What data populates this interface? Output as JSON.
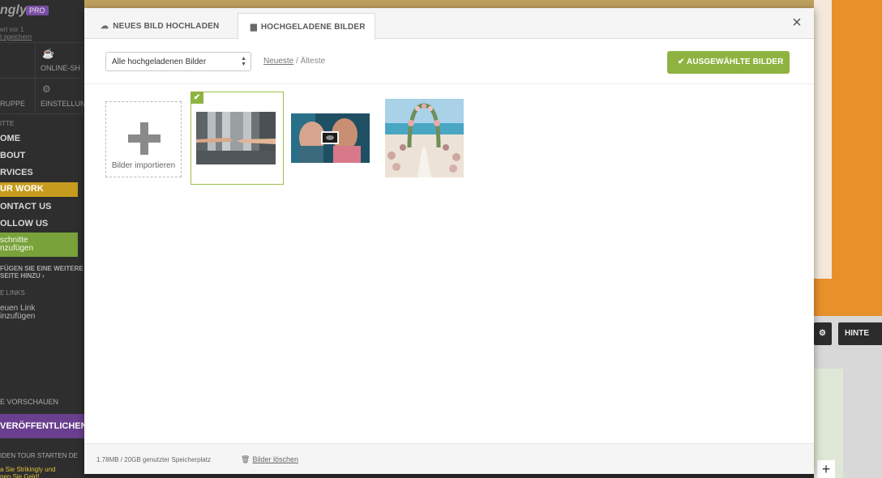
{
  "background": {
    "logo": "ngly",
    "pro_badge": "PRO",
    "saved_note": "ert vor 1\nt speichern",
    "tiles": [
      {
        "label": "",
        "icon": "grid-icon"
      },
      {
        "label": "ONLINE-SH",
        "icon": "shop-icon"
      },
      {
        "label": "RUPPE",
        "icon": "group-icon"
      },
      {
        "label": "EINSTELLUN",
        "icon": "gear-icon"
      }
    ],
    "sections_heading": "ITTE",
    "nav": [
      "OME",
      "BOUT",
      "RVICES"
    ],
    "nav_active": "UR WORK",
    "nav_after": [
      "ONTACT US",
      "OLLOW US"
    ],
    "add_section": "schnitte\nnzufügen",
    "add_page": "FÜGEN SIE EINE WEITERE\nSEITE HINZU ›",
    "links_heading": "E LINKS",
    "new_link": "euen Link\ninzufügen",
    "preview": "E VORSCHAUEN",
    "publish": "VERÖFFENTLICHEN",
    "bottom_links": "IDEN   TOUR STARTEN   DE",
    "promo": "a Sie Strikingly und\nnen Sie Geld!",
    "right_button": "HINTE",
    "colors": {
      "sidebar": "#2e2e2e",
      "active": "#c79c1e",
      "green": "#79a23b",
      "publish": "#6a3f8f"
    }
  },
  "modal": {
    "tabs": [
      {
        "label": "NEUES BILD HOCHLADEN",
        "icon": "cloud-upload-icon",
        "active": false
      },
      {
        "label": "HOCHGELADENE BILDER",
        "icon": "folder-icon",
        "active": true
      }
    ],
    "close_icon": "close-icon",
    "filter": {
      "selected": "Alle hochgeladenen Bilder"
    },
    "sort": {
      "newest": "Neueste",
      "separator": " / ",
      "oldest": "Älteste"
    },
    "primary_button": {
      "label": "AUSGEWÄHLTE BILDER",
      "icon": "check-icon",
      "color": "#8fb340"
    },
    "import_label": "Bilder importieren",
    "images": [
      {
        "name": "hands-reaching",
        "selected": true
      },
      {
        "name": "couple-ultrasound",
        "selected": false
      },
      {
        "name": "beach-wedding-arch",
        "selected": false
      }
    ],
    "footer": {
      "usage": "1.78MB / 20GB genutzter Speicherplatz",
      "delete": "Bilder löschen",
      "delete_icon": "trash-icon"
    }
  }
}
